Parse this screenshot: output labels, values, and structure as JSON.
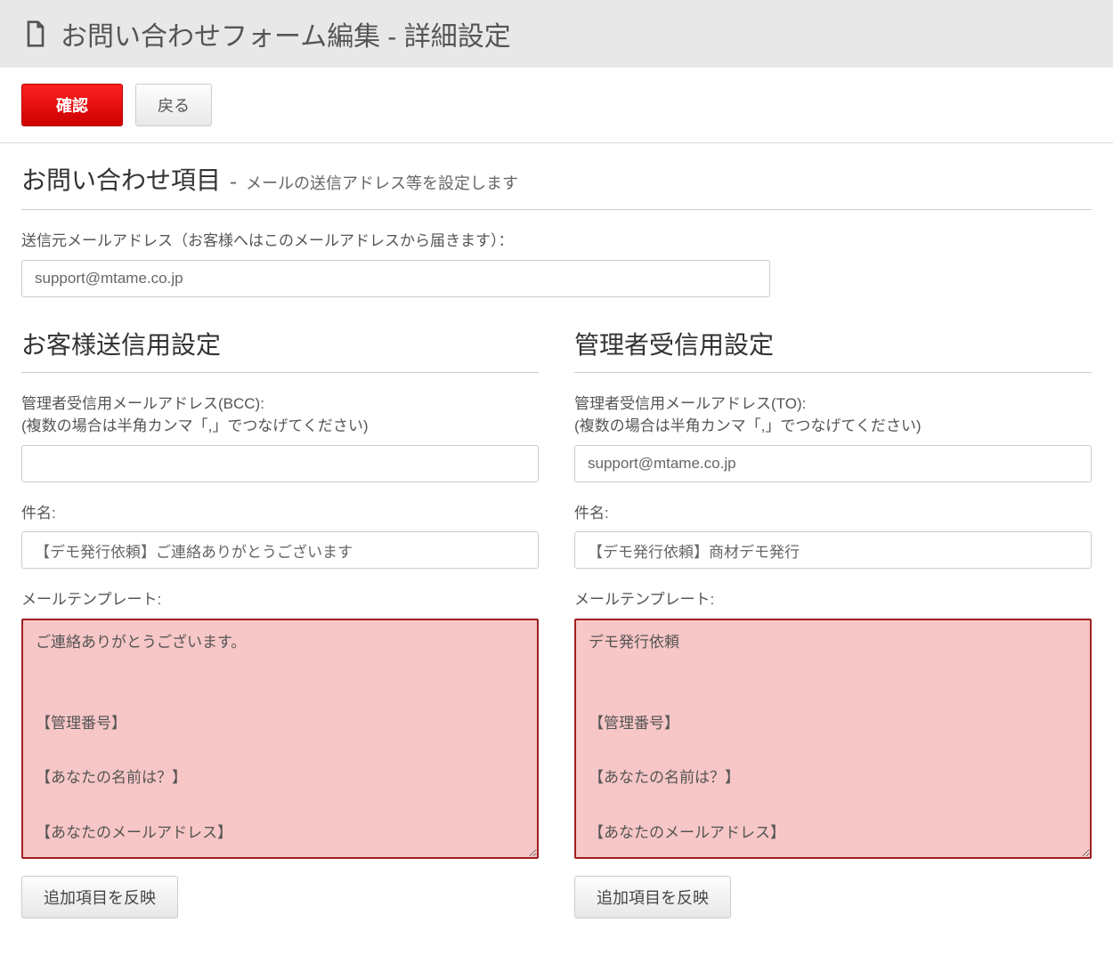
{
  "header": {
    "title": "お問い合わせフォーム編集 - 詳細設定"
  },
  "toolbar": {
    "confirm_label": "確認",
    "back_label": "戻る"
  },
  "section": {
    "title": "お問い合わせ項目",
    "separator": "-",
    "subtitle": "メールの送信アドレス等を設定します"
  },
  "sender": {
    "label": "送信元メールアドレス（お客様へはこのメールアドレスから届きます）：",
    "value": "support@mtame.co.jp"
  },
  "customer": {
    "heading": "お客様送信用設定",
    "bcc_label1": "管理者受信用メールアドレス(BCC):",
    "bcc_label2": "(複数の場合は半角カンマ「,」でつなげてください)",
    "bcc_value": "",
    "subject_label": "件名:",
    "subject_value": "【デモ発行依頼】ご連絡ありがとうございます",
    "template_label": "メールテンプレート:",
    "template_value": "ご連絡ありがとうございます。\n\n\n【管理番号】\n\n【あなたの名前は？】\n\n【あなたのメールアドレス】\n\n【デモ依頼商材】",
    "apply_label": "追加項目を反映"
  },
  "admin": {
    "heading": "管理者受信用設定",
    "to_label1": "管理者受信用メールアドレス(TO):",
    "to_label2": "(複数の場合は半角カンマ「,」でつなげてください)",
    "to_value": "support@mtame.co.jp",
    "subject_label": "件名:",
    "subject_value": "【デモ発行依頼】商材デモ発行",
    "template_label": "メールテンプレート:",
    "template_value": "デモ発行依頼\n\n\n【管理番号】\n\n【あなたの名前は？】\n\n【あなたのメールアドレス】\n\n【デモ依頼商材】",
    "apply_label": "追加項目を反映"
  }
}
